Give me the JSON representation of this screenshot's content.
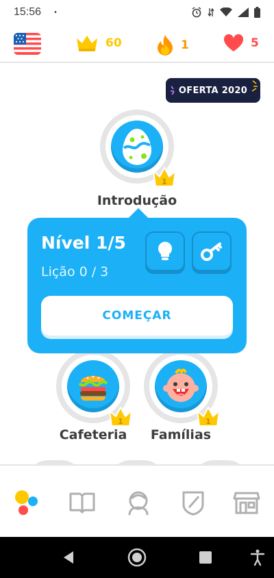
{
  "status_bar": {
    "time": "15:56",
    "dot": "•"
  },
  "stats": {
    "crowns": "60",
    "streak": "1",
    "hearts": "5"
  },
  "promo": {
    "label": "OFERTA 2020"
  },
  "skills": {
    "intro": {
      "label": "Introdução",
      "crown_level": "1"
    },
    "cafeteria": {
      "label": "Cafeteria",
      "crown_level": "1"
    },
    "familias": {
      "label": "Famílias",
      "crown_level": "1"
    }
  },
  "popover": {
    "title": "Nível 1/5",
    "lesson_progress": "Lição 0 / 3",
    "start_label": "COMEÇAR"
  },
  "colors": {
    "accent": "#1cb0f6",
    "crown": "#ffc800",
    "fire": "#ff9600",
    "heart": "#ff4b4b",
    "promo_bg": "#1a2040"
  },
  "icons": {
    "nav": [
      "home-icon",
      "stories-icon",
      "profile-icon",
      "leagues-icon",
      "shop-icon"
    ]
  }
}
